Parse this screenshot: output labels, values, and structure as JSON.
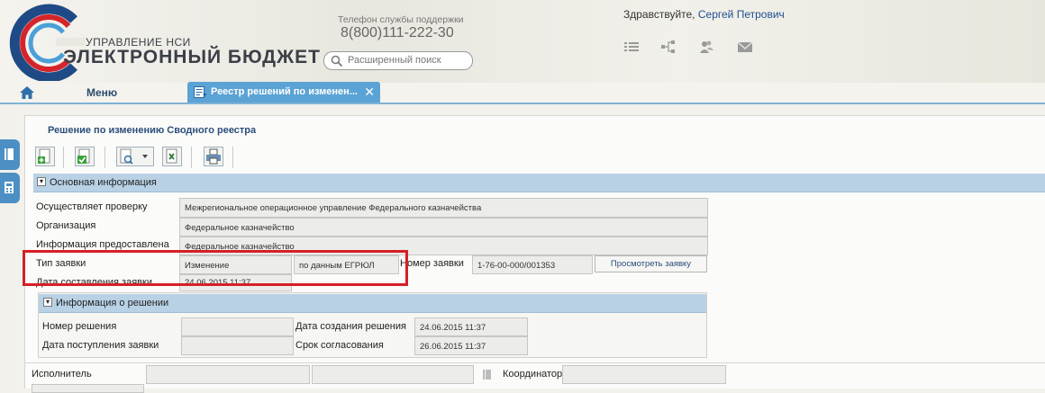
{
  "header": {
    "logo_sub": "УПРАВЛЕНИЕ НСИ",
    "logo_main": "ЭЛЕКТРОННЫЙ БЮДЖЕТ",
    "support_label": "Телефон службы поддержки",
    "support_phone": "8(800)111-222-30",
    "search_placeholder": "Расширенный поиск",
    "greeting": "Здравствуйте,",
    "user_name": "Сергей Петрович",
    "icons": [
      "list-icon",
      "hierarchy-icon",
      "users-icon",
      "mail-icon"
    ]
  },
  "nav": {
    "menu_label": "Меню",
    "active_tab": "Реестр решений по изменен...",
    "close_glyph": "✕"
  },
  "panel": {
    "title": "Решение по изменению Сводного реестра",
    "toolbar": [
      "add-icon",
      "save-check-icon",
      "document-dropdown-icon",
      "excel-export-icon",
      "print-icon"
    ],
    "section_main": "Основная информация",
    "fields": {
      "inspector_label": "Осуществляет проверку",
      "inspector_value": "Межрегиональное операционное управление Федерального казначейства",
      "organization_label": "Организация",
      "organization_value": "Федеральное казначейство",
      "provided_label": "Информация предоставлена",
      "provided_value": "Федеральное казначейство",
      "request_type_label": "Тип заявки",
      "request_type_value": "Изменение",
      "request_source_value": "по данным ЕГРЮЛ",
      "request_number_label": "Номер заявки",
      "request_number_value": "1-76-00-000/001353",
      "view_request_button": "Просмотреть заявку",
      "request_date_label": "Дата составления заявки",
      "request_date_value": "24.06.2015 11:37"
    },
    "section_decision": "Информация о решении",
    "decision": {
      "number_label": "Номер решения",
      "number_value": "",
      "received_label": "Дата поступления заявки",
      "received_value": "",
      "created_label": "Дата создания решения",
      "created_value": "24.06.2015 11:37",
      "deadline_label": "Срок согласования",
      "deadline_value": "26.06.2015 11:37"
    },
    "executor_label": "Исполнитель",
    "coordinator_label": "Координатор"
  },
  "colors": {
    "accent": "#5ba3d5",
    "section": "#b8d1e5",
    "highlight": "#d61f26",
    "title": "#2a4d7b"
  }
}
